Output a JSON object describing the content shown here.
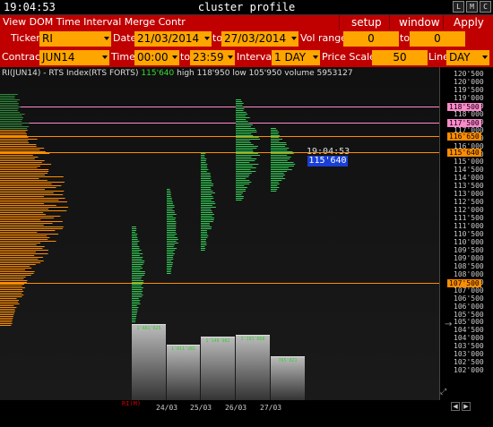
{
  "window": {
    "clock": "19:04:53",
    "title": "cluster profile",
    "buttons": [
      "L",
      "M",
      "C"
    ]
  },
  "menu": {
    "left": "View DOM Time Interval Merge Contr",
    "setup": "setup",
    "window": "window",
    "apply": "Apply"
  },
  "controls": {
    "ticker_label": "Ticker",
    "ticker_value": "RI",
    "date_label": "Date",
    "date_from": "21/03/2014",
    "to_label": "to",
    "date_to": "27/03/2014",
    "volrange_label": "Vol range",
    "volrange_from": "0",
    "volrange_to_label": "to",
    "volrange_to": "0",
    "contract_label": "Contract",
    "contract_value": "JUN14",
    "time_label": "Time",
    "time_from": "00:00",
    "time_to_label": "to",
    "time_to": "23:59",
    "interval_label": "Interval",
    "interval_value": "1 DAY",
    "pricescale_label": "Price Scale",
    "pricescale_value": "50",
    "line_label": "Line",
    "line_value": "DAY"
  },
  "chart_info": {
    "instrument": "RI(JUN14) - RTS Index(RTS FORTS)",
    "last": "115'640",
    "high": "high 118'950",
    "low": "low 105'950",
    "volume": "volume 5953127"
  },
  "stamp_time": "19:04:53",
  "price_box": "115'640",
  "corner_label": "RI(M)",
  "colors": {
    "menu_red": "#c00000",
    "field_orange": "#ffa500",
    "bar_green": "#33cc55",
    "profile_orange": "#ff8c00",
    "marker_pink": "#ff88cc",
    "marker_blue": "#1a3fd6"
  },
  "icons": {
    "dropdown": "chevron-down-icon",
    "crosshair": "crosshair-icon",
    "expand": "expand-icon",
    "scroll_left": "arrow-left-icon",
    "scroll_right": "arrow-right-icon"
  },
  "chart_data": {
    "type": "bar",
    "price_axis": {
      "ticks": [
        "120'500",
        "120'000",
        "119'500",
        "119'000",
        "118'500",
        "118'000",
        "117'500",
        "117'000",
        "116'500",
        "116'000",
        "115'500",
        "115'000",
        "114'500",
        "114'000",
        "113'500",
        "113'000",
        "112'500",
        "112'000",
        "111'500",
        "111'000",
        "110'500",
        "110'000",
        "109'500",
        "109'000",
        "108'500",
        "108'000",
        "107'500",
        "107'000",
        "106'500",
        "106'000",
        "105'500",
        "105'000",
        "104'500",
        "104'000",
        "103'500",
        "103'000",
        "102'500",
        "102'000"
      ],
      "min": 102000,
      "max": 120500
    },
    "markers": [
      {
        "label": "118'500",
        "color": "#ff88cc"
      },
      {
        "label": "117'500",
        "color": "#ff88cc"
      },
      {
        "label": "116'650",
        "color": "#ff8c00"
      },
      {
        "label": "115'640",
        "color": "#ff8c00"
      },
      {
        "label": "107'500",
        "color": "#ff8c00"
      }
    ],
    "days": [
      "24/03",
      "25/03",
      "26/03",
      "27/03"
    ],
    "volume_labels": [
      "1'481'025",
      "1'011'281",
      "1'148'982",
      "1'191'668",
      "765'021"
    ]
  }
}
